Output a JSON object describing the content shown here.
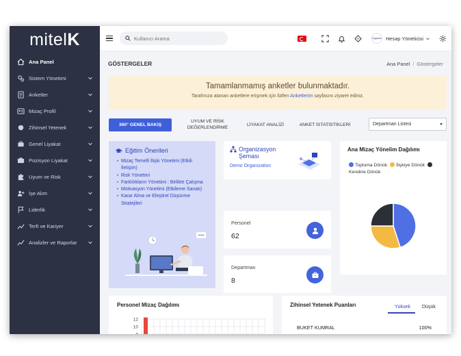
{
  "brand": {
    "logo_text": "mitel",
    "logo_accent": "K"
  },
  "sidebar": {
    "items": [
      {
        "label": "Ana Panel",
        "icon": "home-icon",
        "active": true
      },
      {
        "label": "Sistem Yönetimi",
        "icon": "gears-icon"
      },
      {
        "label": "Anketler",
        "icon": "survey-icon"
      },
      {
        "label": "Mizaç Profil",
        "icon": "profile-card-icon"
      },
      {
        "label": "Zihinsel Yetenek",
        "icon": "brain-icon"
      },
      {
        "label": "Genel Liyakat",
        "icon": "briefcase-icon"
      },
      {
        "label": "Pozisyon Liyakat",
        "icon": "position-icon"
      },
      {
        "label": "Uyum ve Risk",
        "icon": "puzzle-icon"
      },
      {
        "label": "İşe Alım",
        "icon": "user-plus-icon"
      },
      {
        "label": "Liderlik",
        "icon": "flag-icon"
      },
      {
        "label": "Terfi ve Kariyer",
        "icon": "career-icon"
      },
      {
        "label": "Analizler ve Raporlar",
        "icon": "chart-line-icon"
      }
    ]
  },
  "topbar": {
    "search_placeholder": "Kullanıcı Arama",
    "account_label": "Hesap Yöneticisi",
    "avatar_text": "logoplus"
  },
  "page": {
    "title": "GÖSTERGELER",
    "breadcrumb_home": "Ana Panel",
    "breadcrumb_sep": "/",
    "breadcrumb_current": "Göstergeler"
  },
  "alert": {
    "title": "Tamamlanmamış anketler bulunmaktadır.",
    "text_before": "Tarafınıza atanan anketlere erişmek için lütfen",
    "link": "Anketlerim",
    "text_after": "sayfasını ziyaret ediniz."
  },
  "tabs": [
    {
      "label": "360° GENEL BAKIŞ",
      "active": true
    },
    {
      "label": "UYUM VE RİSK DEĞERLENDİRME"
    },
    {
      "label": "LİYAKAT ANALİZİ"
    },
    {
      "label": "ANKET İSTATİSTİKLERİ"
    }
  ],
  "department_select": {
    "value": "Departman Listesi"
  },
  "education": {
    "title": "Eğitim Önerileri",
    "items": [
      "Mizaç Temelli İlişki Yönetimi (Etkili İletişim)",
      "Risk Yönetimi",
      "Farklılıkların Yönetimi : Birlikte Çalışma",
      "Motivasyon Yönetimi (Etkileme Sanatı)",
      "Karar Alma ve Eleştirel Düşünme Stratejileri"
    ]
  },
  "org": {
    "title": "Organizasyon Şeması",
    "subtitle": "Demo Organization"
  },
  "stats": {
    "personel": {
      "label": "Personel",
      "value": "62"
    },
    "departman": {
      "label": "Departman",
      "value": "8"
    }
  },
  "pie": {
    "title": "Ana Mizaç Yönelim Dağılımı",
    "legend": [
      {
        "label": "Topluma Dönük",
        "color": "#4f6fe3"
      },
      {
        "label": "İlişkiye Dönük",
        "color": "#f4b942"
      },
      {
        "label": "Kendine Dönük",
        "color": "#2b2f36"
      }
    ]
  },
  "chart_data": {
    "type": "pie",
    "title": "Ana Mizaç Yönelim Dağılımı",
    "labels": [
      "Topluma Dönük",
      "İlişkiye Dönük",
      "Kendine Dönük"
    ],
    "values": [
      45,
      30,
      25
    ],
    "colors": [
      "#4f6fe3",
      "#f4b942",
      "#2b2f36"
    ]
  },
  "personel_chart": {
    "title": "Personel Mizaç Dağılımı",
    "ticks": [
      "12",
      "10",
      "8"
    ],
    "bar_value_fraction": 0.95,
    "bar_color": "#e8473d"
  },
  "ability": {
    "title": "Zihinsel Yetenek Puanları",
    "tab_high": "Yüksek",
    "tab_low": "Düşük",
    "row_name": "BUKET KUMRAL",
    "row_value": "100%"
  }
}
